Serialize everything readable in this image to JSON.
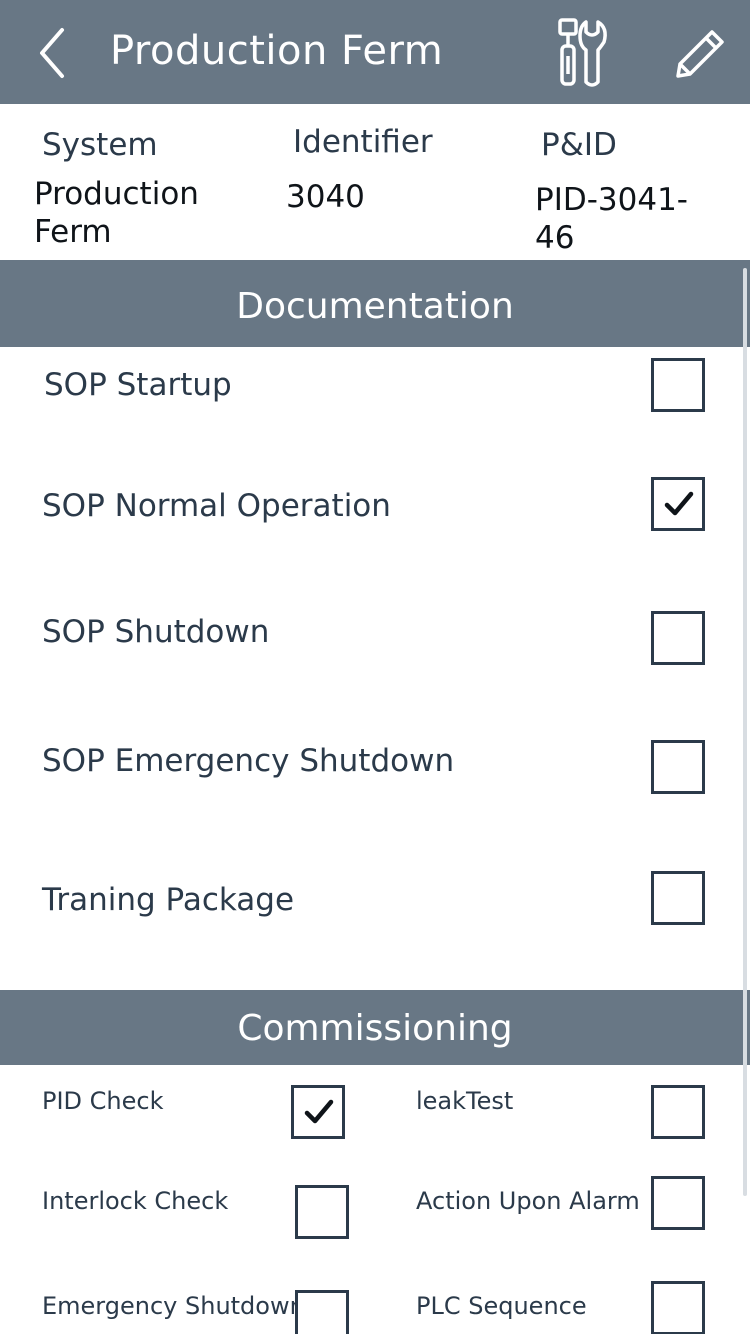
{
  "header": {
    "title": "Production Ferm",
    "back_icon": "chevron-left-icon",
    "tools_icon": "tools-icon",
    "edit_icon": "pencil-icon",
    "bg_color": "#687785"
  },
  "info": {
    "system_label": "System",
    "identifier_label": "Identifier",
    "pid_label": "P&ID",
    "system_value": "Production Ferm",
    "identifier_value": "3040",
    "pid_value": "PID-3041-46"
  },
  "documentation": {
    "title": "Documentation",
    "items": [
      {
        "label": "SOP Startup",
        "checked": false
      },
      {
        "label": "SOP Normal Operation",
        "checked": true
      },
      {
        "label": "SOP Shutdown",
        "checked": false
      },
      {
        "label": "SOP Emergency Shutdown",
        "checked": false
      },
      {
        "label": "Traning Package",
        "checked": false
      }
    ]
  },
  "commissioning": {
    "title": "Commissioning",
    "items": [
      {
        "label": "PID Check",
        "checked": true
      },
      {
        "label": "leakTest",
        "checked": false
      },
      {
        "label": "Interlock Check",
        "checked": false
      },
      {
        "label": "Action Upon Alarm",
        "checked": false
      },
      {
        "label": "Emergency Shutdown",
        "checked": false
      },
      {
        "label": "PLC Sequence",
        "checked": false
      }
    ]
  }
}
